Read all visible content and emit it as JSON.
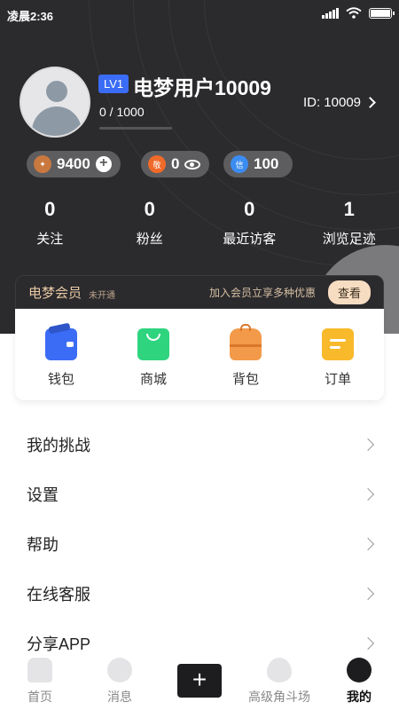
{
  "status_bar": {
    "time": "凌晨2:36"
  },
  "profile": {
    "level": "LV1",
    "username": "电梦用户10009",
    "exp": "0 / 1000",
    "exp_fraction": 0.0,
    "id_label": "ID: 10009"
  },
  "wallet": {
    "coins": "9400",
    "respect": "0",
    "respect_icon_text": "敬",
    "trust": "100",
    "trust_icon_text": "信"
  },
  "stats": [
    {
      "value": "0",
      "label": "关注"
    },
    {
      "value": "0",
      "label": "粉丝"
    },
    {
      "value": "0",
      "label": "最近访客"
    },
    {
      "value": "1",
      "label": "浏览足迹"
    }
  ],
  "vip": {
    "title": "电梦会员",
    "status": "未开通",
    "promo": "加入会员立享多种优惠",
    "button": "查看"
  },
  "features": [
    {
      "label": "钱包",
      "icon": "wallet-icon",
      "color": "#3b6cf5"
    },
    {
      "label": "商城",
      "icon": "shopping-bag-icon",
      "color": "#2fd47f"
    },
    {
      "label": "背包",
      "icon": "backpack-icon",
      "color": "#f39a4a"
    },
    {
      "label": "订单",
      "icon": "order-icon",
      "color": "#f8b92b"
    }
  ],
  "menu": [
    "我的挑战",
    "设置",
    "帮助",
    "在线客服",
    "分享APP"
  ],
  "tabs": [
    {
      "label": "首页",
      "icon": "home-icon"
    },
    {
      "label": "消息",
      "icon": "message-icon"
    },
    {
      "label": "",
      "icon": "add-icon"
    },
    {
      "label": "高级角斗场",
      "icon": "flame-icon"
    },
    {
      "label": "我的",
      "icon": "profile-icon",
      "active": true
    }
  ]
}
